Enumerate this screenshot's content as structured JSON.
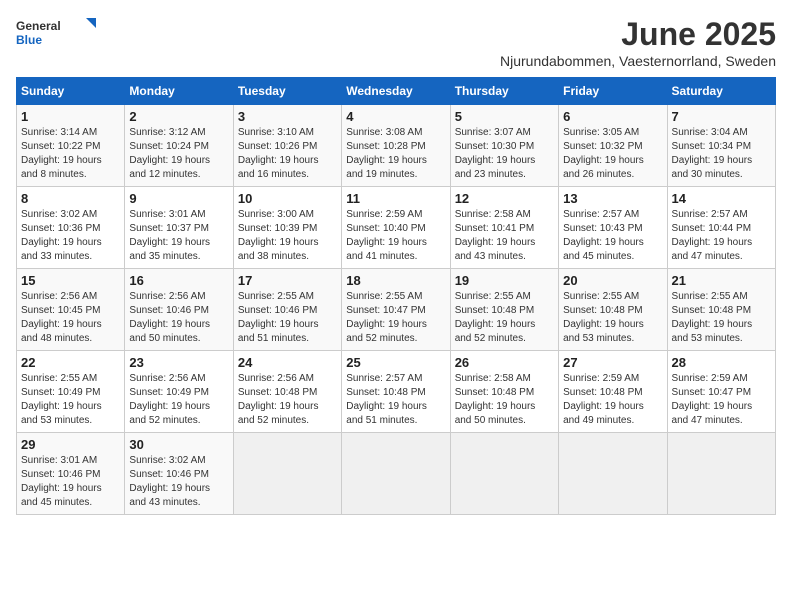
{
  "logo": {
    "general": "General",
    "blue": "Blue"
  },
  "title": "June 2025",
  "subtitle": "Njurundabommen, Vaesternorrland, Sweden",
  "days_of_week": [
    "Sunday",
    "Monday",
    "Tuesday",
    "Wednesday",
    "Thursday",
    "Friday",
    "Saturday"
  ],
  "weeks": [
    [
      {
        "day": "1",
        "sunrise": "Sunrise: 3:14 AM",
        "sunset": "Sunset: 10:22 PM",
        "daylight": "Daylight: 19 hours and 8 minutes."
      },
      {
        "day": "2",
        "sunrise": "Sunrise: 3:12 AM",
        "sunset": "Sunset: 10:24 PM",
        "daylight": "Daylight: 19 hours and 12 minutes."
      },
      {
        "day": "3",
        "sunrise": "Sunrise: 3:10 AM",
        "sunset": "Sunset: 10:26 PM",
        "daylight": "Daylight: 19 hours and 16 minutes."
      },
      {
        "day": "4",
        "sunrise": "Sunrise: 3:08 AM",
        "sunset": "Sunset: 10:28 PM",
        "daylight": "Daylight: 19 hours and 19 minutes."
      },
      {
        "day": "5",
        "sunrise": "Sunrise: 3:07 AM",
        "sunset": "Sunset: 10:30 PM",
        "daylight": "Daylight: 19 hours and 23 minutes."
      },
      {
        "day": "6",
        "sunrise": "Sunrise: 3:05 AM",
        "sunset": "Sunset: 10:32 PM",
        "daylight": "Daylight: 19 hours and 26 minutes."
      },
      {
        "day": "7",
        "sunrise": "Sunrise: 3:04 AM",
        "sunset": "Sunset: 10:34 PM",
        "daylight": "Daylight: 19 hours and 30 minutes."
      }
    ],
    [
      {
        "day": "8",
        "sunrise": "Sunrise: 3:02 AM",
        "sunset": "Sunset: 10:36 PM",
        "daylight": "Daylight: 19 hours and 33 minutes."
      },
      {
        "day": "9",
        "sunrise": "Sunrise: 3:01 AM",
        "sunset": "Sunset: 10:37 PM",
        "daylight": "Daylight: 19 hours and 35 minutes."
      },
      {
        "day": "10",
        "sunrise": "Sunrise: 3:00 AM",
        "sunset": "Sunset: 10:39 PM",
        "daylight": "Daylight: 19 hours and 38 minutes."
      },
      {
        "day": "11",
        "sunrise": "Sunrise: 2:59 AM",
        "sunset": "Sunset: 10:40 PM",
        "daylight": "Daylight: 19 hours and 41 minutes."
      },
      {
        "day": "12",
        "sunrise": "Sunrise: 2:58 AM",
        "sunset": "Sunset: 10:41 PM",
        "daylight": "Daylight: 19 hours and 43 minutes."
      },
      {
        "day": "13",
        "sunrise": "Sunrise: 2:57 AM",
        "sunset": "Sunset: 10:43 PM",
        "daylight": "Daylight: 19 hours and 45 minutes."
      },
      {
        "day": "14",
        "sunrise": "Sunrise: 2:57 AM",
        "sunset": "Sunset: 10:44 PM",
        "daylight": "Daylight: 19 hours and 47 minutes."
      }
    ],
    [
      {
        "day": "15",
        "sunrise": "Sunrise: 2:56 AM",
        "sunset": "Sunset: 10:45 PM",
        "daylight": "Daylight: 19 hours and 48 minutes."
      },
      {
        "day": "16",
        "sunrise": "Sunrise: 2:56 AM",
        "sunset": "Sunset: 10:46 PM",
        "daylight": "Daylight: 19 hours and 50 minutes."
      },
      {
        "day": "17",
        "sunrise": "Sunrise: 2:55 AM",
        "sunset": "Sunset: 10:46 PM",
        "daylight": "Daylight: 19 hours and 51 minutes."
      },
      {
        "day": "18",
        "sunrise": "Sunrise: 2:55 AM",
        "sunset": "Sunset: 10:47 PM",
        "daylight": "Daylight: 19 hours and 52 minutes."
      },
      {
        "day": "19",
        "sunrise": "Sunrise: 2:55 AM",
        "sunset": "Sunset: 10:48 PM",
        "daylight": "Daylight: 19 hours and 52 minutes."
      },
      {
        "day": "20",
        "sunrise": "Sunrise: 2:55 AM",
        "sunset": "Sunset: 10:48 PM",
        "daylight": "Daylight: 19 hours and 53 minutes."
      },
      {
        "day": "21",
        "sunrise": "Sunrise: 2:55 AM",
        "sunset": "Sunset: 10:48 PM",
        "daylight": "Daylight: 19 hours and 53 minutes."
      }
    ],
    [
      {
        "day": "22",
        "sunrise": "Sunrise: 2:55 AM",
        "sunset": "Sunset: 10:49 PM",
        "daylight": "Daylight: 19 hours and 53 minutes."
      },
      {
        "day": "23",
        "sunrise": "Sunrise: 2:56 AM",
        "sunset": "Sunset: 10:49 PM",
        "daylight": "Daylight: 19 hours and 52 minutes."
      },
      {
        "day": "24",
        "sunrise": "Sunrise: 2:56 AM",
        "sunset": "Sunset: 10:48 PM",
        "daylight": "Daylight: 19 hours and 52 minutes."
      },
      {
        "day": "25",
        "sunrise": "Sunrise: 2:57 AM",
        "sunset": "Sunset: 10:48 PM",
        "daylight": "Daylight: 19 hours and 51 minutes."
      },
      {
        "day": "26",
        "sunrise": "Sunrise: 2:58 AM",
        "sunset": "Sunset: 10:48 PM",
        "daylight": "Daylight: 19 hours and 50 minutes."
      },
      {
        "day": "27",
        "sunrise": "Sunrise: 2:59 AM",
        "sunset": "Sunset: 10:48 PM",
        "daylight": "Daylight: 19 hours and 49 minutes."
      },
      {
        "day": "28",
        "sunrise": "Sunrise: 2:59 AM",
        "sunset": "Sunset: 10:47 PM",
        "daylight": "Daylight: 19 hours and 47 minutes."
      }
    ],
    [
      {
        "day": "29",
        "sunrise": "Sunrise: 3:01 AM",
        "sunset": "Sunset: 10:46 PM",
        "daylight": "Daylight: 19 hours and 45 minutes."
      },
      {
        "day": "30",
        "sunrise": "Sunrise: 3:02 AM",
        "sunset": "Sunset: 10:46 PM",
        "daylight": "Daylight: 19 hours and 43 minutes."
      },
      null,
      null,
      null,
      null,
      null
    ]
  ]
}
